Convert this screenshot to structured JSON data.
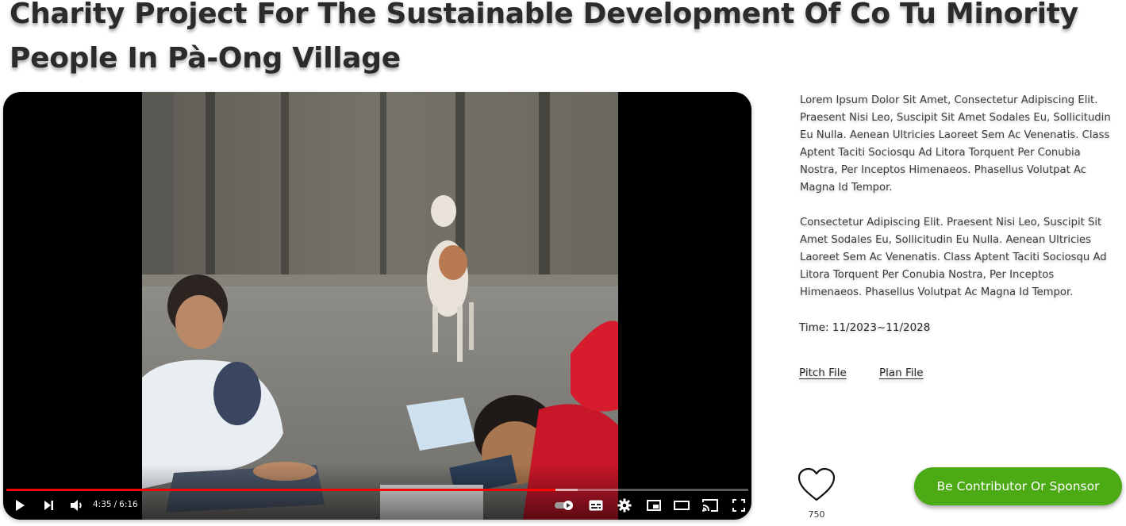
{
  "page": {
    "title": "Charity Project For The Sustainable Development Of Co Tu Minority People In Pà-Ong Village"
  },
  "video": {
    "current_time": "4:35",
    "separator": "/",
    "duration": "6:16",
    "played_fraction": 0.74,
    "controls": [
      "play-icon",
      "next-icon",
      "volume-icon",
      "autoplay-toggle-icon",
      "subtitles-icon",
      "settings-icon",
      "miniplayer-icon",
      "theater-mode-icon",
      "cast-icon",
      "fullscreen-icon"
    ]
  },
  "description": {
    "paragraph_1": "Lorem Ipsum Dolor Sit Amet, Consectetur Adipiscing Elit. Praesent Nisi Leo, Suscipit Sit Amet Sodales Eu, Sollicitudin Eu Nulla. Aenean Ultricies Laoreet Sem Ac Venenatis. Class Aptent Taciti Sociosqu Ad Litora Torquent Per Conubia Nostra, Per Inceptos Himenaeos. Phasellus Volutpat Ac Magna Id Tempor.",
    "paragraph_2": "Consectetur Adipiscing Elit. Praesent Nisi Leo, Suscipit Sit Amet Sodales Eu, Sollicitudin Eu Nulla. Aenean Ultricies Laoreet Sem Ac Venenatis. Class Aptent Taciti Sociosqu Ad Litora Torquent Per Conubia Nostra, Per Inceptos Himenaeos. Phasellus Volutpat Ac Magna Id Tempor."
  },
  "project": {
    "time_range": "Time: 11/2023~11/2028"
  },
  "files": {
    "pitch_label": "Pitch File",
    "plan_label": "Plan File"
  },
  "like": {
    "icon": "heart-icon",
    "count": "750"
  },
  "cta": {
    "label": "Be Contributor Or Sponsor"
  },
  "colors": {
    "cta_green": "#4caa15",
    "progress_red": "#ff0000",
    "player_bg": "#000000"
  }
}
